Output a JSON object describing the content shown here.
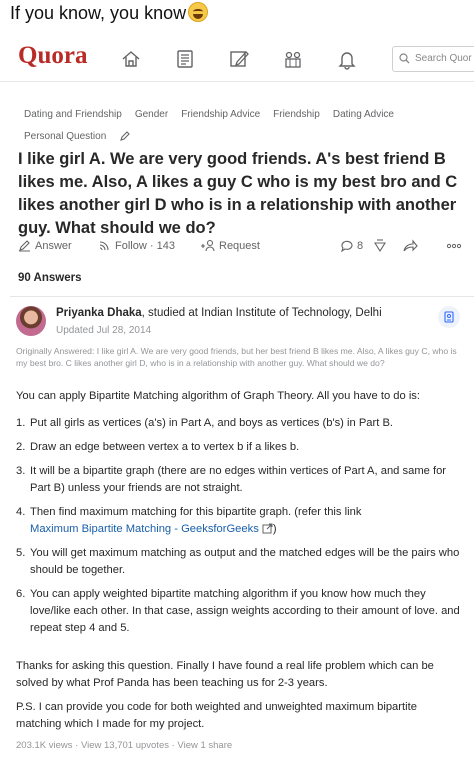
{
  "caption": "If you know, you know",
  "caption_emoji": "laughing-face-emoji",
  "header": {
    "logo": "Quora",
    "search_placeholder": "Search Quor",
    "brand_color": "#b92b27",
    "nav_icons": [
      "home-icon",
      "answer-feed-icon",
      "write-icon",
      "spaces-icon",
      "notifications-icon"
    ]
  },
  "topics": [
    "Dating and Friendship",
    "Gender",
    "Friendship Advice",
    "Friendship",
    "Dating Advice",
    "Personal Question"
  ],
  "question": "I like girl A. We are very good friends. A's best friend B likes me. Also, A likes a guy C who is my best bro and C likes another girl D who is in a relationship with another guy. What should we do?",
  "actions": {
    "answer": "Answer",
    "follow": "Follow",
    "follow_count": "143",
    "request": "Request",
    "comments": "8"
  },
  "answers_count": "90 Answers",
  "answer": {
    "author_name": "Priyanka Dhaka",
    "author_credential": ", studied at Indian Institute of Technology, Delhi",
    "updated": "Updated Jul 28, 2014",
    "originally_answered": "Originally Answered: I like girl A. We are very good friends, but her best friend B likes me. Also, A likes guy C, who is my best bro. C likes another girl D, who is in a relationship with another guy. What should we do?",
    "intro": "You can apply Bipartite Matching algorithm of Graph Theory. All you have to do is:",
    "steps": [
      {
        "num": "1.",
        "text": "Put all girls as vertices (a's) in Part A, and boys as vertices (b's) in Part B."
      },
      {
        "num": "2.",
        "text": "Draw an edge between vertex a to vertex b if a likes b."
      },
      {
        "num": "3.",
        "text": "It will be a bipartite graph (there are no edges within vertices of Part A, and same for Part B) unless your friends are not straight."
      },
      {
        "num": "4.",
        "text": "Then find maximum matching for this bipartite graph. (refer this link",
        "link": "Maximum Bipartite Matching - GeeksforGeeks",
        "after": ")"
      },
      {
        "num": "5.",
        "text": "You will get maximum matching as output and the matched edges will be the pairs who should be together."
      },
      {
        "num": "6.",
        "text": "You can apply weighted bipartite matching algorithm if you know how much they love/like each other. In that case, assign weights according to their amount of love. and repeat step 4 and 5."
      }
    ],
    "thanks": "Thanks for asking this question. Finally I have found a real life problem which can be solved by what Prof Panda has been teaching us for 2-3 years.",
    "ps": "P.S. I can provide you code for both weighted and unweighted maximum bipartite matching which I made for my project.",
    "stats": "203.1K views · View 13,701 upvotes · View 1 share"
  }
}
